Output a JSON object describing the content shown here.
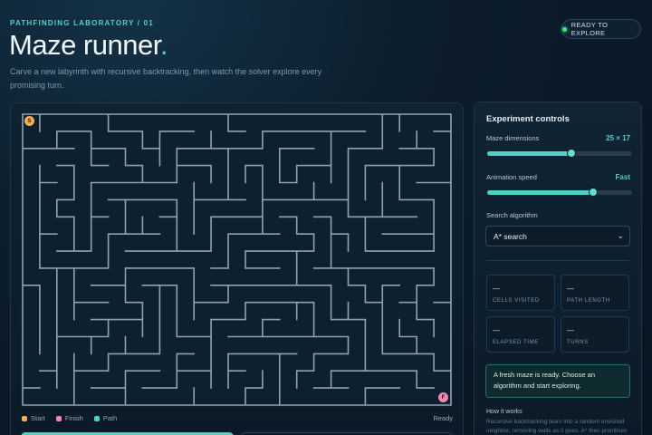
{
  "header": {
    "eyebrow": "PATHFINDING LABORATORY / 01",
    "title": "Maze runner",
    "title_dot": ".",
    "subtitle": "Carve a new labyrinth with recursive backtracking, then watch the solver explore every promising turn.",
    "status": "READY TO EXPLORE"
  },
  "maze": {
    "start_marker": "S",
    "finish_marker": "F",
    "status": "Ready",
    "legend": [
      {
        "label": "Start",
        "color": "#f6ad55"
      },
      {
        "label": "Finish",
        "color": "#f687b3"
      },
      {
        "label": "Path",
        "color": "#4fd1c5"
      }
    ]
  },
  "controls": {
    "title": "Experiment controls",
    "dimensions_label": "Maze dimensions",
    "dimensions_value": "25 × 17",
    "dimensions_level": 0.58,
    "speed_label": "Animation speed",
    "speed_value": "Fast",
    "speed_level": 0.73,
    "algorithm_label": "Search algorithm",
    "algorithm_selected": "A* search",
    "stats": [
      {
        "value": "—",
        "label": "CELLS VISITED"
      },
      {
        "value": "—",
        "label": "PATH LENGTH"
      },
      {
        "value": "—",
        "label": "ELAPSED TIME"
      },
      {
        "value": "—",
        "label": "TURNS"
      }
    ],
    "notice": "A fresh maze is ready. Choose an algorithm and start exploring.",
    "how_title": "How it works",
    "how_text": "Recursive backtracking tears into a random unvisited neighbor, removing walls as it goes. A* then prioritises"
  },
  "colors": {
    "accent": "#4fd1c5",
    "wall": "#8da3b4",
    "status_dot": "#4ade80"
  }
}
